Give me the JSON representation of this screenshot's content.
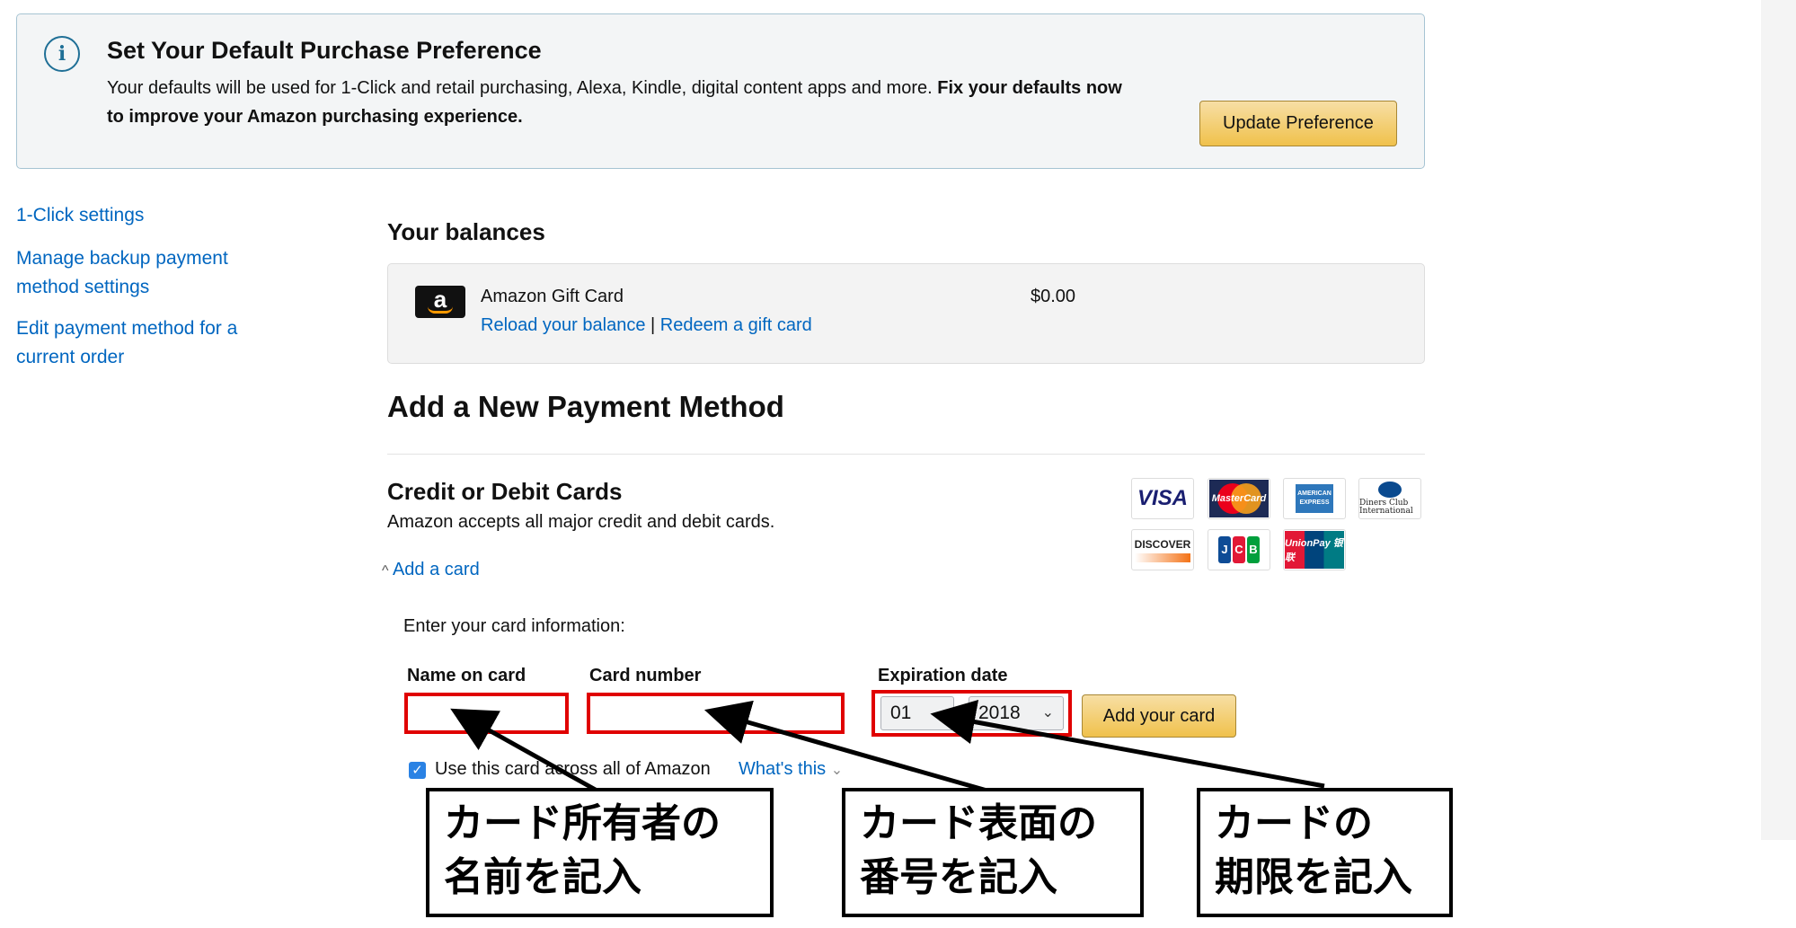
{
  "banner": {
    "title": "Set Your Default Purchase Preference",
    "text_plain": "Your defaults will be used for 1-Click and retail purchasing, Alexa, Kindle, digital content apps and more. ",
    "text_bold": "Fix your defaults now to improve your Amazon purchasing experience.",
    "button": "Update Preference",
    "icon": "info-icon"
  },
  "sidebar": {
    "items": [
      {
        "label": "1-Click settings"
      },
      {
        "label": "Manage backup payment method settings"
      },
      {
        "label": "Edit payment method for a current order"
      }
    ]
  },
  "balances": {
    "heading": "Your balances",
    "gift_card": {
      "icon_letter": "a",
      "label": "Amazon Gift Card",
      "amount": "$0.00",
      "reload_link": "Reload your balance",
      "separator": "|",
      "redeem_link": "Redeem a gift card"
    }
  },
  "add_method": {
    "heading": "Add a New Payment Method",
    "cards_heading": "Credit or Debit Cards",
    "cards_desc": "Amazon accepts all major credit and debit cards.",
    "card_logos": {
      "visa": "VISA",
      "mastercard": "MasterCard",
      "amex": "AMERICAN EXPRESS",
      "diners": "Diners Club International",
      "discover": "DISCOVER",
      "jcb": [
        "J",
        "C",
        "B"
      ],
      "unionpay": "UnionPay 银联"
    },
    "toggle_icon": "^",
    "toggle_label": "Add a card",
    "enter_info": "Enter your card information:",
    "fields": {
      "name_label": "Name on card",
      "number_label": "Card number",
      "expiration_label": "Expiration date",
      "name_value": "",
      "number_value": "",
      "month": "01",
      "year": "2018"
    },
    "add_button": "Add your card",
    "use_across_label": "Use this card across all of Amazon",
    "use_across_checked": true,
    "whats_this": "What's this",
    "whats_this_chevron": "⌄"
  },
  "annotations": {
    "name_callout": "カード所有者の\n名前を記入",
    "number_callout": "カード表面の\n番号を記入",
    "expiry_callout": "カードの\n期限を記入"
  },
  "colors": {
    "link": "#0066c0",
    "highlight": "#e00000",
    "button": "#f0c14b",
    "banner_border": "#a6c4d3"
  }
}
